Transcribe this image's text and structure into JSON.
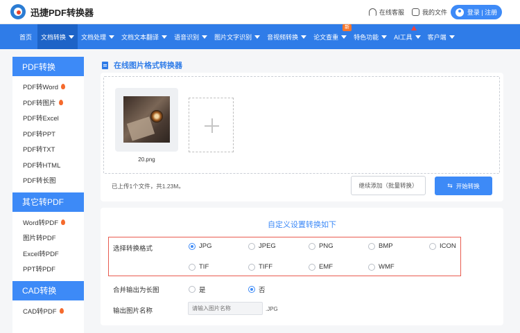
{
  "header": {
    "brand": "迅捷PDF转换器",
    "service_label": "在线客服",
    "my_files_label": "我的文件",
    "login_label": "登录 | 注册"
  },
  "nav": {
    "items": [
      {
        "label": "首页"
      },
      {
        "label": "文档转换"
      },
      {
        "label": "文档处理"
      },
      {
        "label": "文档文本翻译"
      },
      {
        "label": "语音识别"
      },
      {
        "label": "图片文字识别"
      },
      {
        "label": "音视频转换"
      },
      {
        "label": "论文查重"
      },
      {
        "label": "特色功能"
      },
      {
        "label": "AI工具"
      },
      {
        "label": "客户端"
      }
    ],
    "new_badge": "新"
  },
  "sidebar": {
    "sections": [
      {
        "title": "PDF转换",
        "items": [
          "PDF转Word",
          "PDF转图片",
          "PDF转Excel",
          "PDF转PPT",
          "PDF转TXT",
          "PDF转HTML",
          "PDF转长图"
        ]
      },
      {
        "title": "其它转PDF",
        "items": [
          "Word转PDF",
          "图片转PDF",
          "Excel转PDF",
          "PPT转PDF"
        ]
      },
      {
        "title": "CAD转换",
        "items": [
          "CAD转PDF"
        ]
      }
    ]
  },
  "main": {
    "title": "在线图片格式转换器",
    "file_name": "20.png",
    "upload_info": "已上传1个文件，共1.23M。",
    "continue_label": "继续添加（批量转换）",
    "start_label": "开始转换"
  },
  "settings": {
    "title": "自定义设置转换如下",
    "format_label": "选择转换格式",
    "formats": [
      "JPG",
      "JPEG",
      "PNG",
      "BMP",
      "ICON",
      "TIF",
      "TIFF",
      "EMF",
      "WMF"
    ],
    "selected_format": "JPG",
    "merge_label": "合并输出为长图",
    "merge_yes": "是",
    "merge_no": "否",
    "merge_selected": "否",
    "name_label": "输出图片名称",
    "name_placeholder": "请输入图片名称",
    "name_suffix": ".JPG"
  },
  "colors": {
    "primary": "#2f7ce8",
    "button": "#3d8af7",
    "highlight_border": "#e85b4f",
    "hot_flame": "#f56a2d"
  }
}
